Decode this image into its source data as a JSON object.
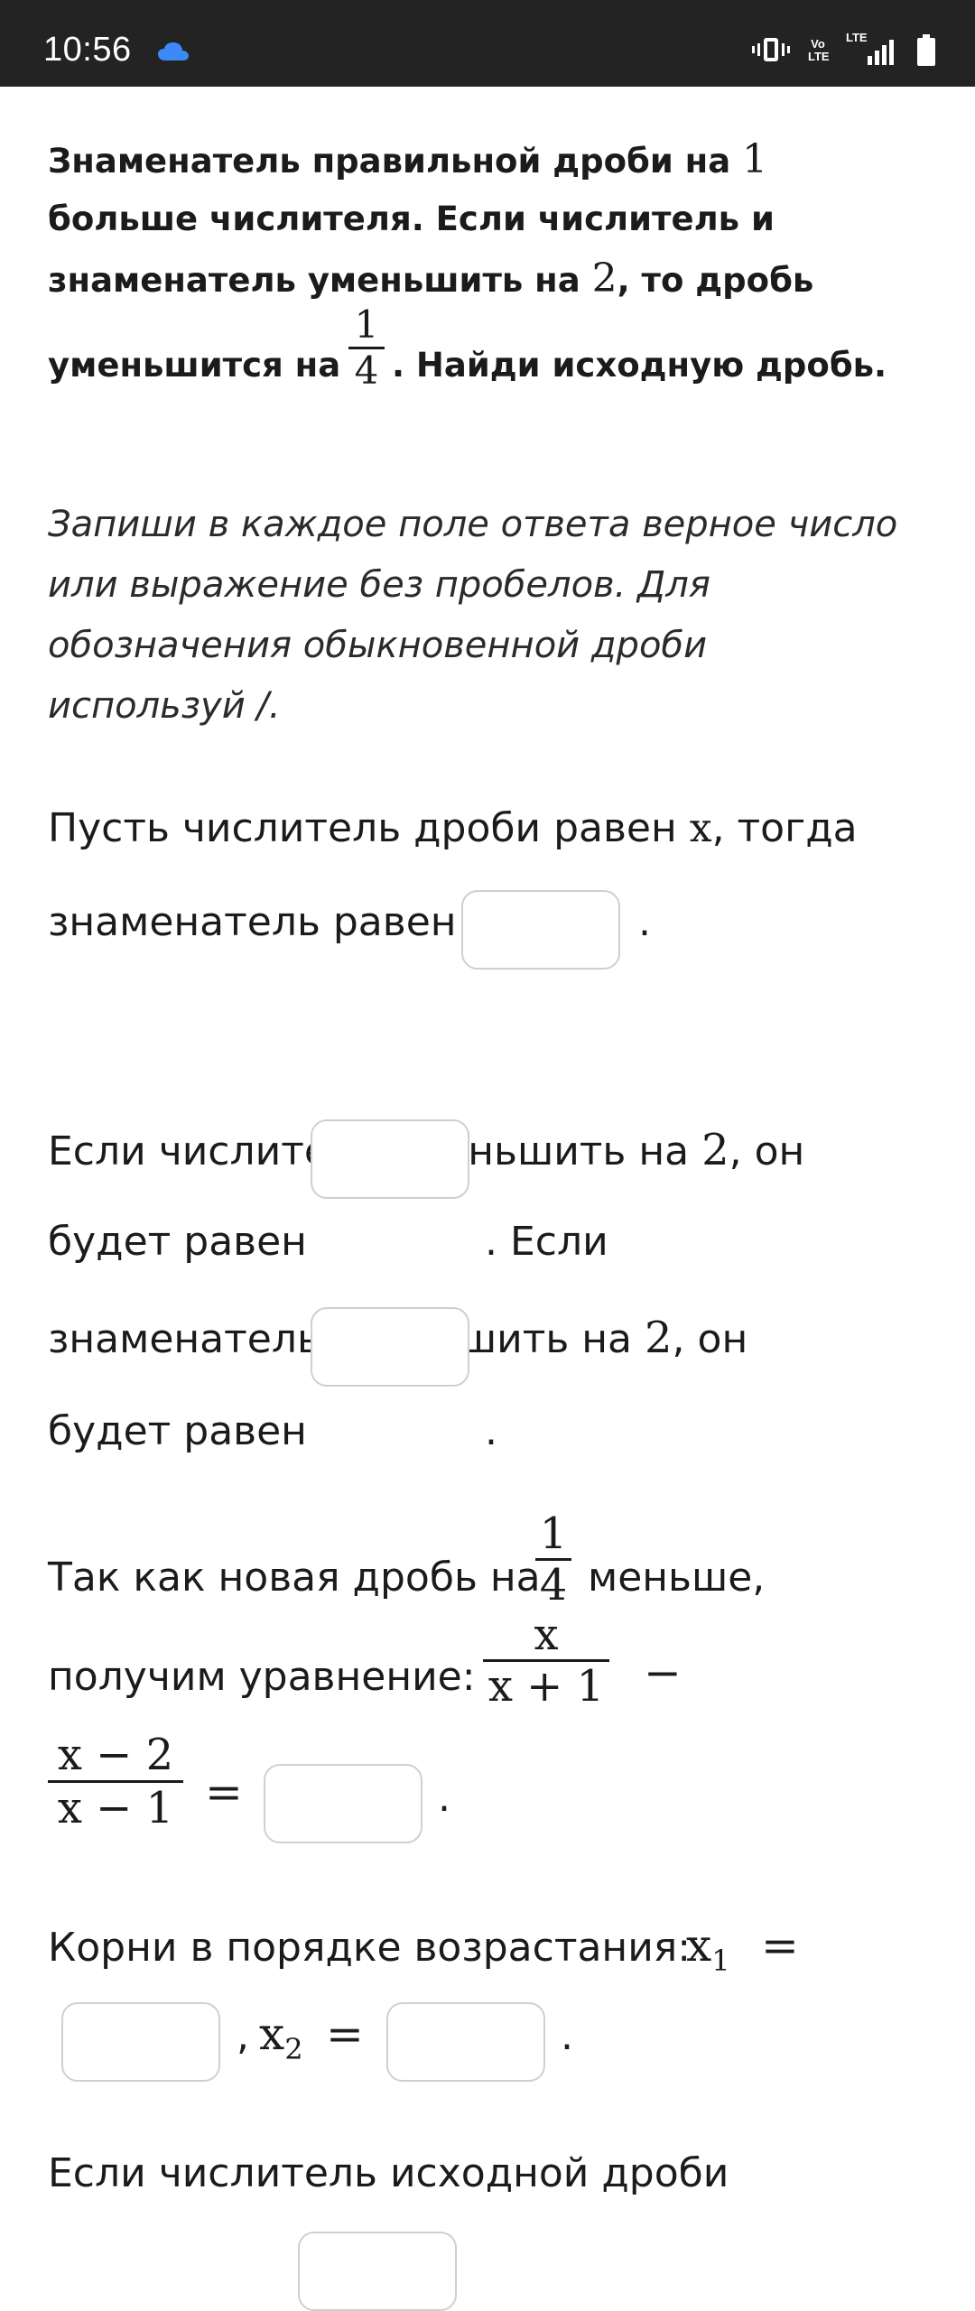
{
  "status_bar": {
    "time": "10:56",
    "volte_label": "Vo LTE",
    "lte_label": "LTE",
    "icons": [
      "cloud-icon",
      "vibrate-icon",
      "volte-icon",
      "signal-icon",
      "battery-icon"
    ]
  },
  "question": {
    "l1_text": "Знаменатель правильной дроби на ",
    "l1_num": "1",
    "l2": "больше числителя. Если числитель и",
    "l3_text": "знаменатель уменьшить на ",
    "l3_num": "2",
    "l3_tail": ", то дробь",
    "l4_text": "уменьшится на",
    "l4_frac_num": "1",
    "l4_frac_den": "4",
    "l4_tail": ". Найди исходную дробь."
  },
  "instructions": {
    "l1": "Запиши в каждое поле ответа верное число",
    "l2": "или выражение без пробелов. Для",
    "l3": "обозначения обыкновенной дроби",
    "l4": "используй /."
  },
  "step1": {
    "a": "Пусть числитель дроби равен ",
    "var": "x",
    "b": ", тогда",
    "c": "знаменатель равен",
    "dot": "."
  },
  "step2": {
    "a": "Если числитель уменьшить на ",
    "num": "2",
    "b": ", он",
    "c": "будет равен",
    "d": ". Если",
    "e": "знаменатель уменьшить на ",
    "num2": "2",
    "f": ", он",
    "g": "будет равен",
    "dot": "."
  },
  "step3": {
    "a": "Так как новая дробь на",
    "frac_num": "1",
    "frac_den": "4",
    "b": "меньше,",
    "c": "получим уравнение:",
    "f1_num": "x",
    "f1_den": "x + 1",
    "minus": "−",
    "f2_num": "x − 2",
    "f2_den": "x − 1",
    "eq": "=",
    "dot": "."
  },
  "step4": {
    "a": "Корни в порядке возрастания:",
    "x1": "x",
    "sub1": "1",
    "eq": "=",
    "comma": ",",
    "x2": "x",
    "sub2": "2",
    "dot": "."
  },
  "step5": {
    "a": "Если числитель исходной дроби"
  }
}
